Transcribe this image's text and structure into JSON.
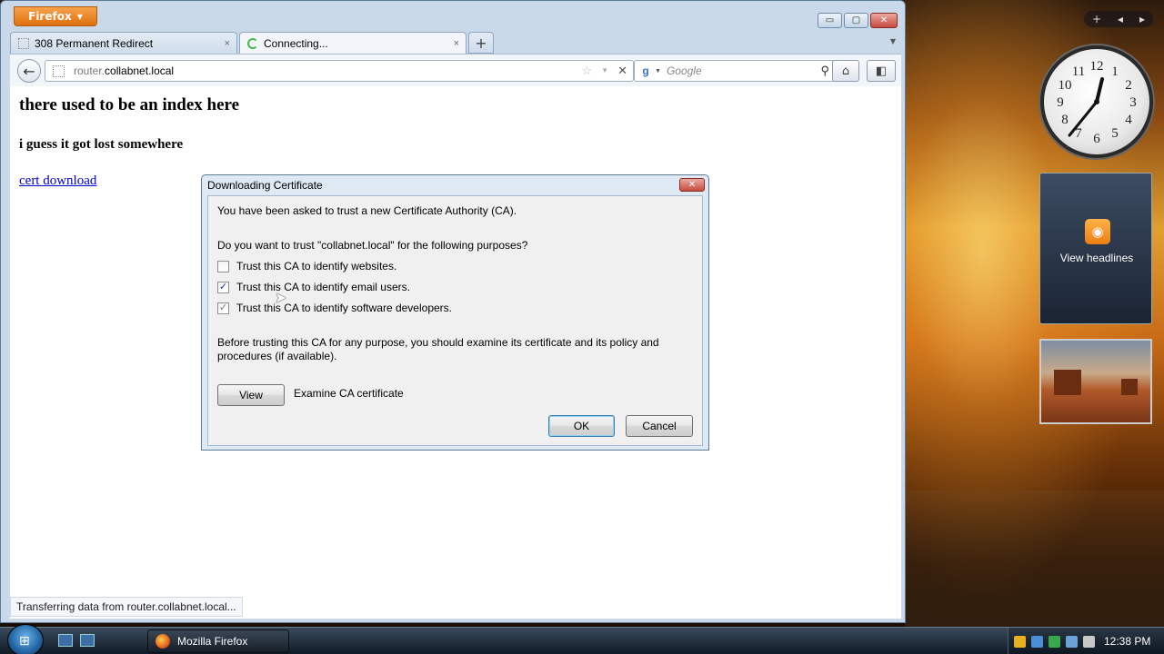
{
  "browser": {
    "app_button": "Firefox",
    "window_controls": {
      "minimize": "▭",
      "maximize": "▢",
      "close": "✕"
    },
    "tabs": [
      {
        "title": "308 Permanent Redirect",
        "close": "×"
      },
      {
        "title": "Connecting...",
        "close": "×"
      }
    ],
    "new_tab": "+",
    "tab_list": "▼",
    "back": "←",
    "url": {
      "host_prefix": "router.",
      "host_rest": "collabnet.local"
    },
    "url_actions": {
      "star": "☆",
      "dropdown": "▼",
      "stop": "✕"
    },
    "search": {
      "engine_icon": "g",
      "placeholder": "Google",
      "button": "⚲"
    },
    "home": "⌂",
    "addon": "◧",
    "status": "Transferring data from router.collabnet.local..."
  },
  "page": {
    "heading": "there used to be an index here",
    "subheading": "i guess it got lost somewhere",
    "link": "cert download"
  },
  "dialog": {
    "title": "Downloading Certificate",
    "close": "✕",
    "intro": "You have been asked to trust a new Certificate Authority (CA).",
    "question": "Do you want to trust \"collabnet.local\" for the following purposes?",
    "options": [
      {
        "label": "Trust this CA to identify websites.",
        "checked": false,
        "mark": ""
      },
      {
        "label": "Trust this CA to identify email users.",
        "checked": true,
        "mark": "✓"
      },
      {
        "label": "Trust this CA to identify software developers.",
        "checked": true,
        "mark": "✓"
      }
    ],
    "note": "Before trusting this CA for any purpose, you should examine its certificate and its policy and procedures (if available).",
    "view_button": "View",
    "view_label": "Examine CA certificate",
    "ok_button": "OK",
    "cancel_button": "Cancel"
  },
  "sidebar": {
    "controls": {
      "add": "+",
      "prev": "◂",
      "next": "▸"
    },
    "feed_label": "View headlines",
    "rss": "◉",
    "clock_numbers": [
      "12",
      "1",
      "2",
      "3",
      "4",
      "5",
      "6",
      "7",
      "8",
      "9",
      "10",
      "11"
    ]
  },
  "taskbar": {
    "start_flag": "⊞",
    "task": "Mozilla Firefox",
    "time": "12:38 PM"
  }
}
